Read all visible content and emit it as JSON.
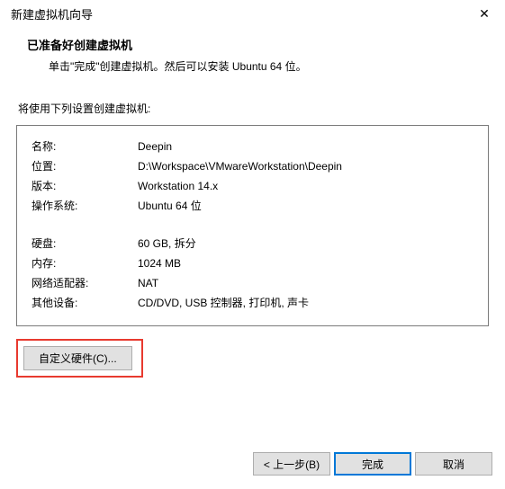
{
  "window": {
    "title": "新建虚拟机向导"
  },
  "header": {
    "heading": "已准备好创建虚拟机",
    "subheading": "单击\"完成\"创建虚拟机。然后可以安装 Ubuntu 64 位。"
  },
  "body_label": "将使用下列设置创建虚拟机:",
  "settings": [
    {
      "label": "名称:",
      "value": "Deepin"
    },
    {
      "label": "位置:",
      "value": "D:\\Workspace\\VMwareWorkstation\\Deepin"
    },
    {
      "label": "版本:",
      "value": "Workstation 14.x"
    },
    {
      "label": "操作系统:",
      "value": "Ubuntu 64 位"
    }
  ],
  "settings2": [
    {
      "label": "硬盘:",
      "value": "60 GB, 拆分"
    },
    {
      "label": "内存:",
      "value": "1024 MB"
    },
    {
      "label": "网络适配器:",
      "value": "NAT"
    },
    {
      "label": "其他设备:",
      "value": "CD/DVD, USB 控制器, 打印机, 声卡"
    }
  ],
  "buttons": {
    "customize": "自定义硬件(C)...",
    "back": "< 上一步(B)",
    "finish": "完成",
    "cancel": "取消"
  }
}
